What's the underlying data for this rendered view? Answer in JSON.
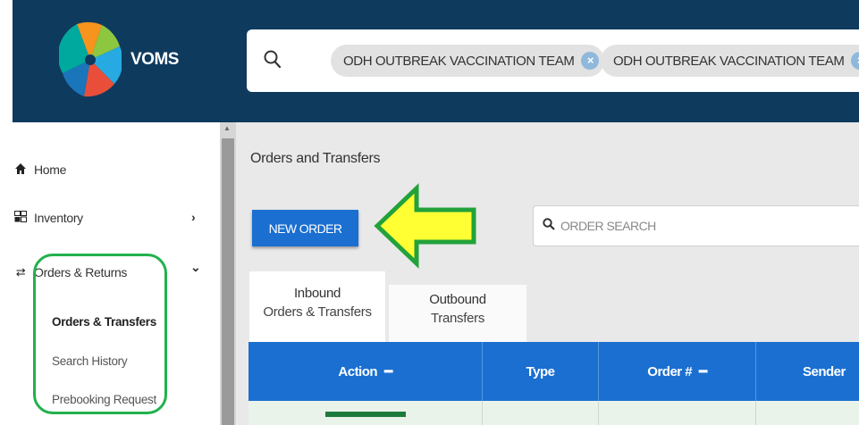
{
  "app": {
    "name": "VOMS"
  },
  "header": {
    "search_icon": "search-icon",
    "chips": [
      {
        "label": "ODH OUTBREAK VACCINATION TEAM",
        "close": "×"
      },
      {
        "label": "ODH OUTBREAK VACCINATION TEAM",
        "close": "×"
      }
    ]
  },
  "sidebar": {
    "items": [
      {
        "label": "Home",
        "icon": "home-icon",
        "glyph": "🏠"
      },
      {
        "label": "Inventory",
        "icon": "inventory-icon",
        "glyph": "📦",
        "chevron": "›"
      },
      {
        "label": "Orders & Returns",
        "icon": "transfer-icon",
        "glyph": "⇄",
        "chevron": "⌄"
      }
    ],
    "sub_items": [
      {
        "label": "Orders & Transfers",
        "active": true
      },
      {
        "label": "Search History",
        "active": false
      },
      {
        "label": "Prebooking Request",
        "active": false
      }
    ]
  },
  "main": {
    "page_title": "Orders and Transfers",
    "new_order_label": "NEW ORDER",
    "order_search_placeholder": "ORDER SEARCH",
    "help_glyph": "?",
    "tabs": [
      {
        "line1": "Inbound",
        "line2": "Orders & Transfers",
        "active": true
      },
      {
        "line1": "Outbound",
        "line2": "Transfers",
        "active": false
      }
    ],
    "table": {
      "columns": [
        {
          "label": "Action",
          "sort": "━"
        },
        {
          "label": "Type",
          "sort": ""
        },
        {
          "label": "Order #",
          "sort": "━"
        },
        {
          "label": "Sender",
          "sort": ""
        }
      ]
    }
  },
  "colors": {
    "header_bg": "#0e3a5e",
    "primary_blue": "#1a6fd1",
    "highlight_green": "#22b14c",
    "arrow_yellow": "#ffff33"
  }
}
